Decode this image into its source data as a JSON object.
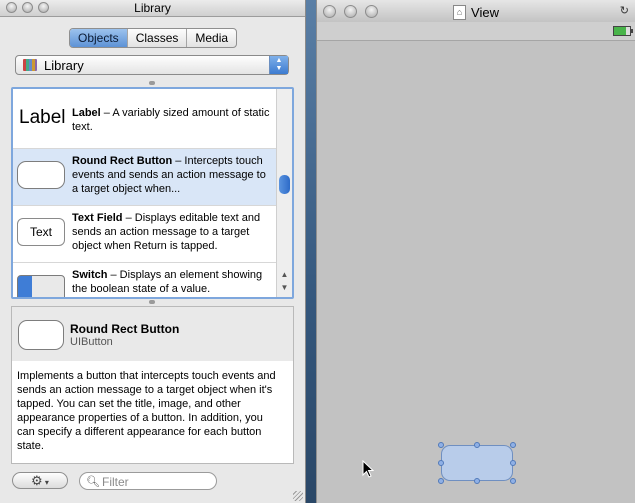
{
  "library": {
    "title": "Library",
    "tabs": [
      {
        "label": "Objects",
        "active": true
      },
      {
        "label": "Classes",
        "active": false
      },
      {
        "label": "Media",
        "active": false
      }
    ],
    "popup": {
      "value": "Library"
    },
    "items": [
      {
        "icon_text": "Label",
        "name": "Label",
        "desc": " – A variably sized amount of static text."
      },
      {
        "icon_text": "",
        "name": "Round Rect Button",
        "desc": " – Intercepts touch events and sends an action message to a target object when..."
      },
      {
        "icon_text": "Text",
        "name": "Text Field",
        "desc": " – Displays editable text and sends an action message to a target object when Return is tapped."
      },
      {
        "icon_text": "",
        "name": "Switch",
        "desc": " – Displays an element showing the boolean state of a value."
      }
    ],
    "detail": {
      "name": "Round Rect Button",
      "class": "UIButton",
      "description": "Implements a button that intercepts touch events and sends an action message to a target object when it's tapped. You can set the title, image, and other appearance properties of a button. In addition, you can specify a different appearance for each button state."
    },
    "filter": {
      "placeholder": "Filter",
      "value": ""
    }
  },
  "view_window": {
    "title": "View",
    "doc_icon": "nib-document-icon"
  },
  "colors": {
    "accent": "#5d92d6",
    "selection_row": "#d9e6f7",
    "canvas": "#c2c2c2"
  }
}
